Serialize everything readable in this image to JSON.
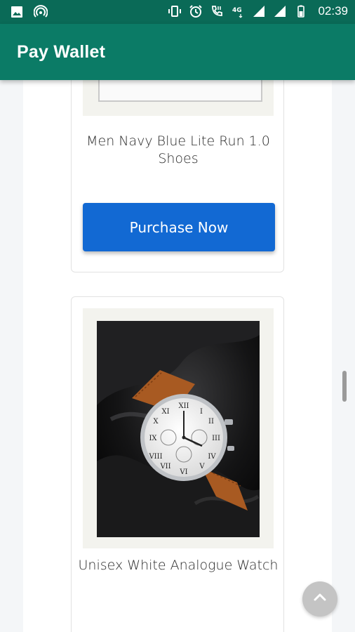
{
  "status_bar": {
    "time": "02:39",
    "icons": [
      "gallery-icon",
      "hotspot-icon",
      "vibrate-icon",
      "alarm-icon",
      "volte-call-icon",
      "4g-icon",
      "signal-icon",
      "signal-icon",
      "battery-icon"
    ],
    "network_label": "4G"
  },
  "app_bar": {
    "title": "Pay Wallet",
    "color": "#0b7b66"
  },
  "products": [
    {
      "name": "Men Navy Blue Lite Run 1.0 Shoes",
      "button_label": "Purchase Now"
    },
    {
      "name": "Unisex White Analogue Watch"
    }
  ],
  "colors": {
    "primary_button": "#1269d3",
    "status_bar": "#0a6a57"
  },
  "scroll_top_button": {
    "icon": "chevron-up-icon"
  }
}
